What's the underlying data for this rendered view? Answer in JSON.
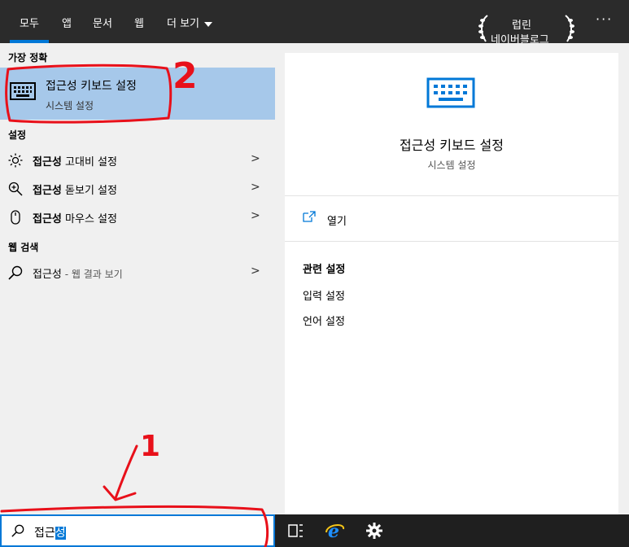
{
  "tabs": [
    {
      "label": "모두",
      "active": true
    },
    {
      "label": "앱",
      "active": false
    },
    {
      "label": "문서",
      "active": false
    },
    {
      "label": "웹",
      "active": false
    },
    {
      "label": "더 보기",
      "active": false,
      "has_dropdown": true
    }
  ],
  "brand": {
    "line1": "럽린",
    "line2": "네이버블로그"
  },
  "more_menu": "···",
  "left": {
    "best_match_heading": "가장 정확",
    "best_match": {
      "title": "접근성 키보드 설정",
      "subtitle": "시스템 설정",
      "icon": "keyboard-icon"
    },
    "settings_heading": "설정",
    "settings": [
      {
        "bold": "접근성",
        "rest": " 고대비 설정",
        "icon": "sun-icon"
      },
      {
        "bold": "접근성",
        "rest": " 돋보기 설정",
        "icon": "magnifier-icon"
      },
      {
        "bold": "접근성",
        "rest": " 마우스 설정",
        "icon": "mouse-icon"
      }
    ],
    "web_heading": "웹 검색",
    "web_item": {
      "main": "접근성",
      "suffix": " - 웹 결과 보기",
      "icon": "search-icon"
    },
    "chevron": ">"
  },
  "right": {
    "title": "접근성 키보드 설정",
    "subtitle": "시스템 설정",
    "open_label": "열기",
    "related_heading": "관련 설정",
    "related": [
      "입력 설정",
      "언어 설정"
    ]
  },
  "search": {
    "typed": "접근",
    "selected": "성"
  },
  "annotations": {
    "mark1": "1",
    "mark2": "2"
  },
  "colors": {
    "accent": "#0078d7",
    "selection": "#a6c8ea",
    "annotation": "#e8101a"
  }
}
